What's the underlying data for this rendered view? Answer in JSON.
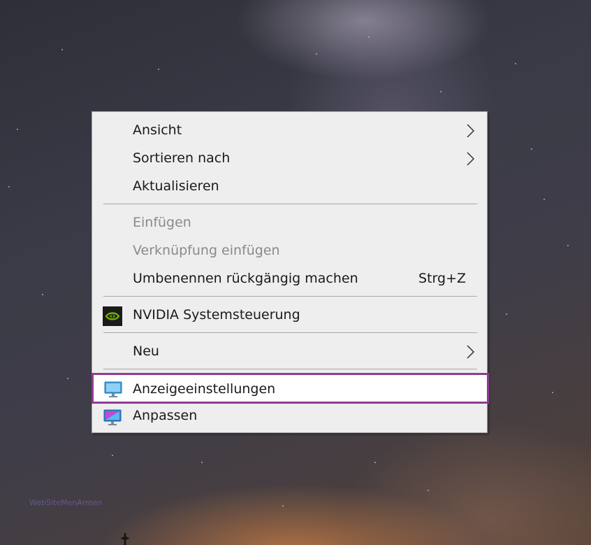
{
  "menu": {
    "items": [
      {
        "label": "Ansicht",
        "has_submenu": true
      },
      {
        "label": "Sortieren nach",
        "has_submenu": true
      },
      {
        "label": "Aktualisieren"
      },
      {
        "label": "Einfügen",
        "disabled": true
      },
      {
        "label": "Verknüpfung einfügen",
        "disabled": true
      },
      {
        "label": "Umbenennen rückgängig machen",
        "shortcut": "Strg+Z"
      },
      {
        "label": "NVIDIA Systemsteuerung",
        "icon": "nvidia-icon"
      },
      {
        "label": "Neu",
        "has_submenu": true
      },
      {
        "label": "Anzeigeeinstellungen",
        "icon": "display-settings-icon",
        "highlighted": true
      },
      {
        "label": "Anpassen",
        "icon": "personalize-icon"
      }
    ]
  },
  "desktop": {
    "watermark": "WebSiteMenArmen"
  },
  "colors": {
    "menu_background": "#eeeeee",
    "highlight_border": "#8e3c91",
    "disabled_text": "#8a8a8a",
    "nvidia_green": "#76b900"
  }
}
